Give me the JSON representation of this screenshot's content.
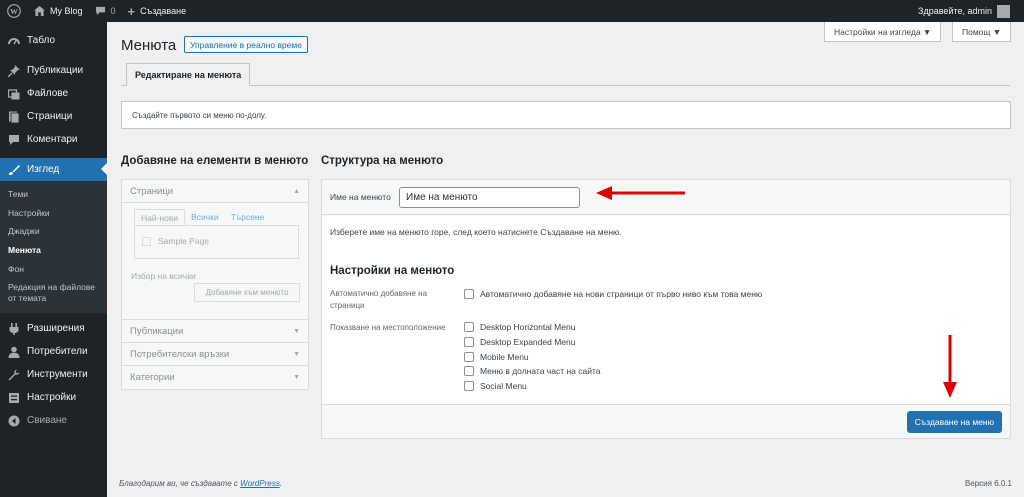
{
  "adminbar": {
    "site_name": "My Blog",
    "comments_count": "0",
    "new_label": "Създаване",
    "greeting": "Здравейте, admin"
  },
  "sidebar": {
    "items": [
      {
        "label": "Табло",
        "icon": "dashboard-icon"
      },
      {
        "label": "Публикации",
        "icon": "pin-icon"
      },
      {
        "label": "Файлове",
        "icon": "media-icon"
      },
      {
        "label": "Страници",
        "icon": "page-icon"
      },
      {
        "label": "Коментари",
        "icon": "comment-icon"
      },
      {
        "label": "Изглед",
        "icon": "brush-icon"
      }
    ],
    "submenu": [
      "Теми",
      "Настройки",
      "Джаджи",
      "Менюта",
      "Фон",
      "Редакция на файлове от темата"
    ],
    "items_after": [
      {
        "label": "Разширения",
        "icon": "plugin-icon"
      },
      {
        "label": "Потребители",
        "icon": "users-icon"
      },
      {
        "label": "Инструменти",
        "icon": "tools-icon"
      },
      {
        "label": "Настройки",
        "icon": "settings-icon"
      }
    ],
    "collapse_label": "Свиване"
  },
  "header": {
    "screen_options": "Настройки на изгледа ▼",
    "help": "Помощ ▼",
    "title": "Менюта",
    "live_button": "Управление в реално време",
    "tab_edit": "Редактиране на менюта",
    "notice": "Създайте първото си меню по-долу."
  },
  "add_items": {
    "heading": "Добавяне на елементи в менюто",
    "pages_title": "Страници",
    "tabs": [
      "Най-нови",
      "Всички",
      "Търсене"
    ],
    "sample_page": "Sample Page",
    "select_all": "Избор на всички",
    "add_button": "Добавяне към менюто",
    "other_sections": [
      "Публикации",
      "Потребителски връзки",
      "Категории"
    ]
  },
  "structure": {
    "heading": "Структура на менюто",
    "name_label": "Име на менюто",
    "name_value": "Име на менюто",
    "instructions": "Изберете име на менюто горе, след което натиснете Създаване на меню.",
    "settings_heading": "Настройки на менюто",
    "auto_add_label": "Автоматично добавяне на страници",
    "auto_add_option": "Автоматично добавяне на нови страници от първо ниво към това меню",
    "location_label": "Показване на местоположение",
    "locations": [
      "Desktop Horizontal Menu",
      "Desktop Expanded Menu",
      "Mobile Menu",
      "Меню в долната част на сайта",
      "Social Menu"
    ],
    "create_button": "Създаване на меню"
  },
  "footer": {
    "thanks_prefix": "Благодарим ви, че създавате с ",
    "wordpress_link": "WordPress",
    "thanks_suffix": ".",
    "version": "Версия 6.0.1"
  },
  "colors": {
    "admin_bar": "#1d2327",
    "accent": "#2271b1",
    "annotation_arrow": "#e00000"
  }
}
